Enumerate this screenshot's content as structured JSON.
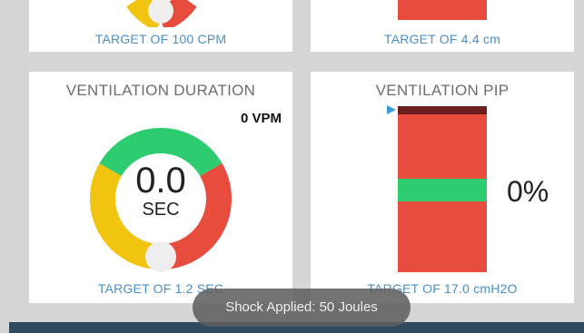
{
  "top_left": {
    "target_text": "TARGET OF 100 CPM"
  },
  "top_right": {
    "target_text": "TARGET OF 4.4  cm"
  },
  "duration": {
    "title": "VENTILATION DURATION",
    "rate": "0 VPM",
    "value": "0.0",
    "unit": "SEC",
    "target_text": "TARGET OF 1.2 SEC"
  },
  "pip": {
    "title": "VENTILATION PIP",
    "percent": "0%",
    "target_text": "TARGET OF 17.0 cmH2O"
  },
  "toast": {
    "message": "Shock Applied: 50 Joules"
  },
  "colors": {
    "green": "#2ecc71",
    "red": "#e74c3c",
    "yellow": "#f1c40f",
    "dark_red": "#6b1f1f",
    "marker_blue": "#3a9ad9",
    "target_blue": "#4a8fc4"
  }
}
